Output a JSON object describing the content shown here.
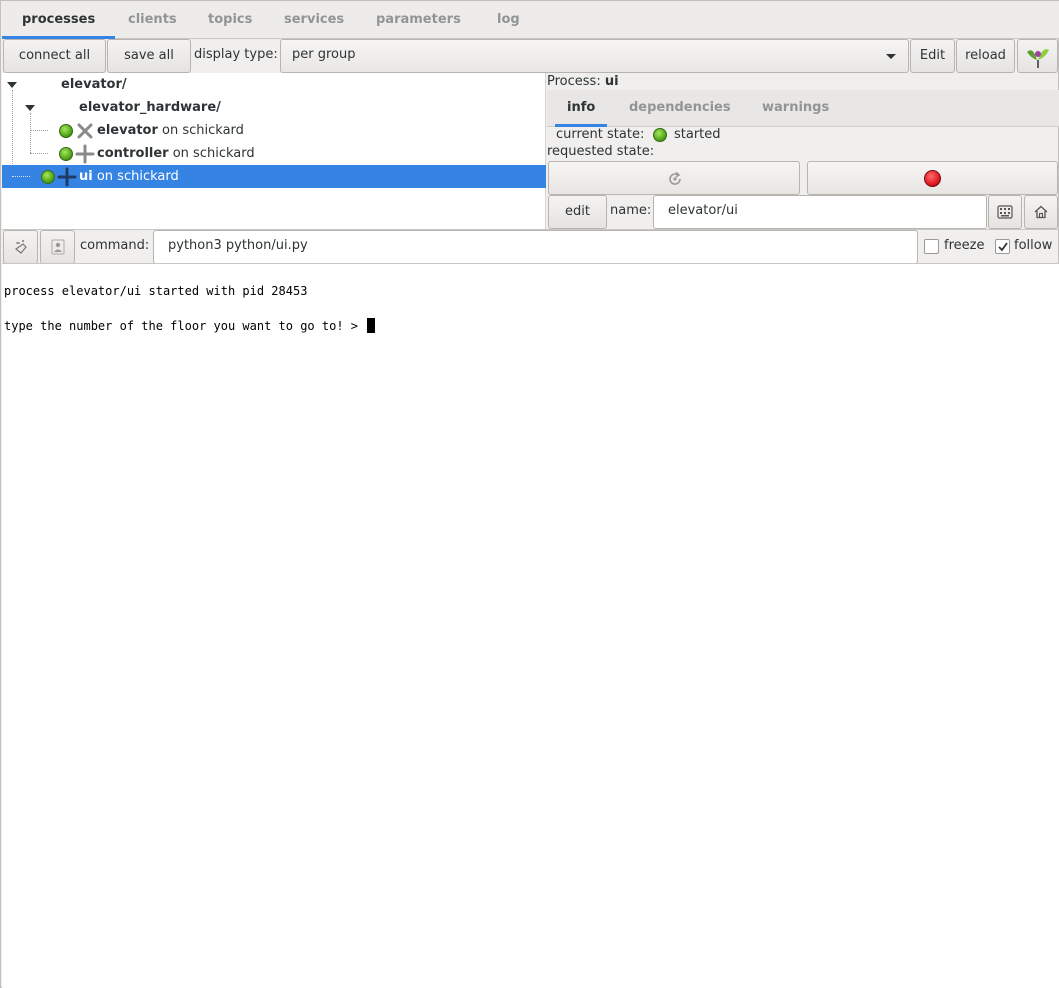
{
  "tabs": [
    {
      "label": "processes",
      "active": true
    },
    {
      "label": "clients"
    },
    {
      "label": "topics"
    },
    {
      "label": "services"
    },
    {
      "label": "parameters"
    },
    {
      "label": "log"
    }
  ],
  "toolbar": {
    "connect_all": "connect all",
    "save_all": "save all",
    "display_type_label": "display type:",
    "display_type_value": "per group",
    "edit": "Edit",
    "reload": "reload",
    "logo_icon": "leaf-logo-icon"
  },
  "tree": {
    "groups": [
      {
        "label": "elevator/"
      },
      {
        "label": "elevator_hardware/"
      }
    ],
    "processes": [
      {
        "name": "elevator",
        "host": " on schickard",
        "state": "started",
        "status_icon": "cross-icon"
      },
      {
        "name": "controller",
        "host": " on schickard",
        "state": "started",
        "status_icon": "plus-icon"
      },
      {
        "name": "ui",
        "host": " on schickard",
        "state": "started",
        "status_icon": "plus-icon",
        "selected": true
      }
    ]
  },
  "process_panel": {
    "title_label": "Process:",
    "title_name": "ui",
    "subtabs": [
      {
        "label": "info",
        "active": true
      },
      {
        "label": "dependencies"
      },
      {
        "label": "warnings"
      }
    ],
    "current_state_label": "current state:",
    "current_state_value": "started",
    "requested_state_label": "requested state:",
    "edit_label": "edit",
    "name_label": "name:",
    "name_value": "elevator/ui"
  },
  "command_bar": {
    "command_label": "command:",
    "command_value": "python3 python/ui.py",
    "freeze_label": "freeze",
    "freeze_checked": false,
    "follow_label": "follow",
    "follow_checked": true
  },
  "console": {
    "lines": [
      "process elevator/ui started with pid 28453",
      "type the number of the floor you want to go to! > "
    ]
  },
  "colors": {
    "accent": "#3584e4",
    "selection": "#3584e4",
    "status_green": "#4ba017",
    "stop_red": "#e01b24"
  }
}
